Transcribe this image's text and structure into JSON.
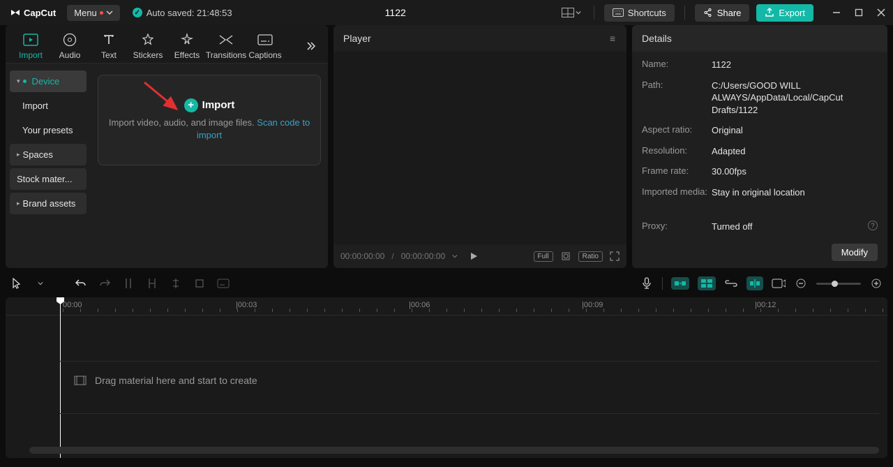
{
  "titlebar": {
    "app_name": "CapCut",
    "menu_label": "Menu",
    "autosave_label": "Auto saved: 21:48:53",
    "project_title": "1122",
    "shortcuts_label": "Shortcuts",
    "share_label": "Share",
    "export_label": "Export"
  },
  "media_tabs": [
    {
      "label": "Import",
      "icon": "import-icon"
    },
    {
      "label": "Audio",
      "icon": "audio-icon"
    },
    {
      "label": "Text",
      "icon": "text-icon"
    },
    {
      "label": "Stickers",
      "icon": "stickers-icon"
    },
    {
      "label": "Effects",
      "icon": "effects-icon"
    },
    {
      "label": "Transitions",
      "icon": "transitions-icon"
    },
    {
      "label": "Captions",
      "icon": "captions-icon"
    }
  ],
  "sidebar": {
    "items": [
      {
        "label": "Device",
        "type": "parent-active"
      },
      {
        "label": "Import",
        "type": "child"
      },
      {
        "label": "Your presets",
        "type": "child"
      },
      {
        "label": "Spaces",
        "type": "group"
      },
      {
        "label": "Stock mater...",
        "type": "group"
      },
      {
        "label": "Brand assets",
        "type": "group"
      }
    ]
  },
  "import_card": {
    "title": "Import",
    "desc_prefix": "Import video, audio, and image files. ",
    "desc_link": "Scan code to import"
  },
  "player": {
    "title": "Player",
    "time_current": "00:00:00:00",
    "time_total": "00:00:00:00",
    "full_badge": "Full",
    "ratio_badge": "Ratio"
  },
  "details": {
    "title": "Details",
    "rows": [
      {
        "label": "Name:",
        "value": "1122"
      },
      {
        "label": "Path:",
        "value": "C:/Users/GOOD WILL ALWAYS/AppData/Local/CapCut Drafts/1122"
      },
      {
        "label": "Aspect ratio:",
        "value": "Original"
      },
      {
        "label": "Resolution:",
        "value": "Adapted"
      },
      {
        "label": "Frame rate:",
        "value": "30.00fps"
      },
      {
        "label": "Imported media:",
        "value": "Stay in original location"
      }
    ],
    "proxy_label": "Proxy:",
    "proxy_value": "Turned off",
    "modify_label": "Modify"
  },
  "timeline": {
    "labels": [
      "00:00",
      "00:03",
      "00:06",
      "00:09",
      "00:12"
    ],
    "hint": "Drag material here and start to create"
  }
}
